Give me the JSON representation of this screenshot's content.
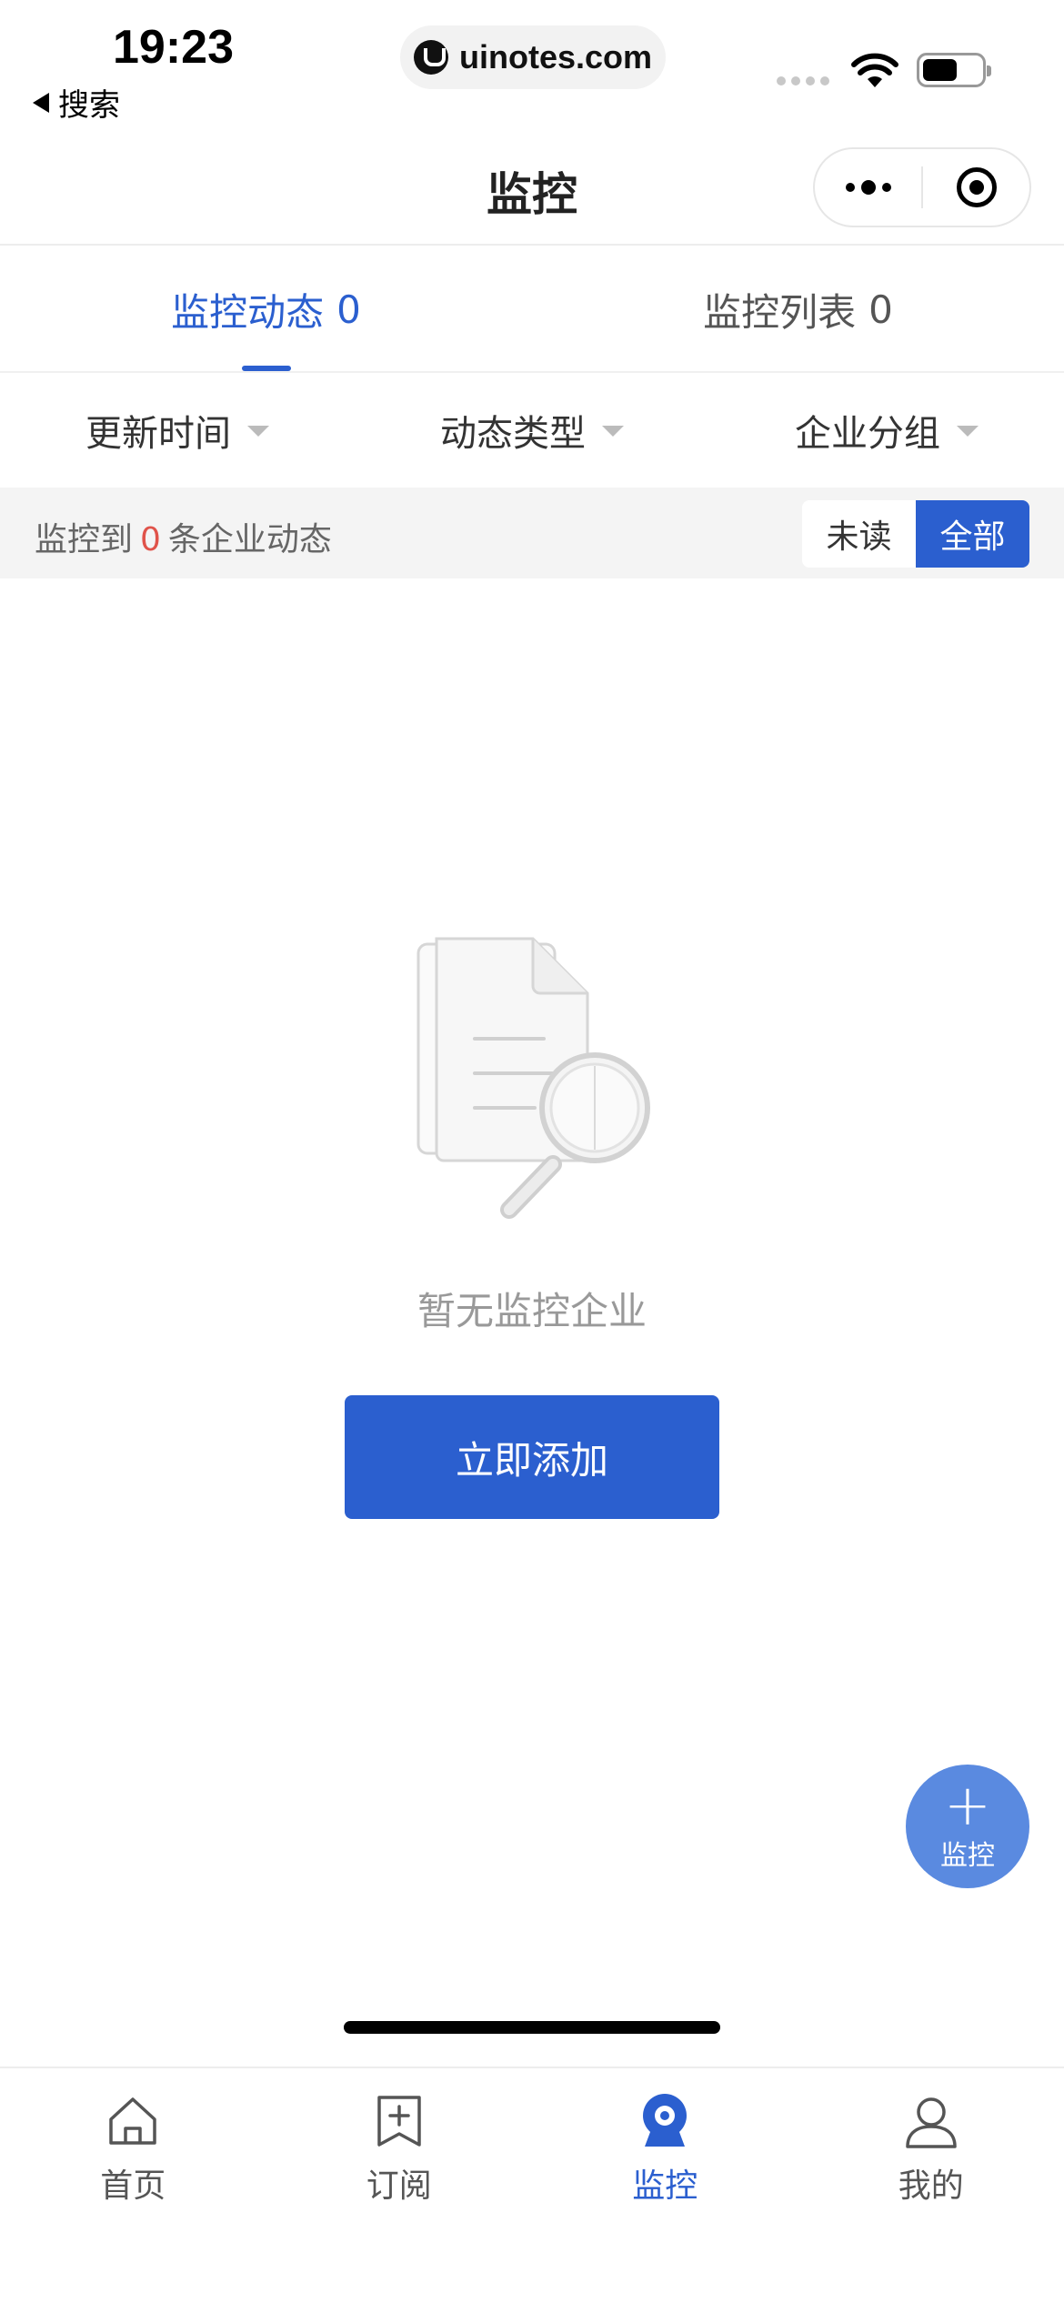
{
  "status_bar": {
    "time": "19:23",
    "back_label": "搜索",
    "url": "uinotes.com"
  },
  "nav": {
    "title": "监控"
  },
  "tabs": [
    {
      "label": "监控动态",
      "count": "0",
      "active": true
    },
    {
      "label": "监控列表",
      "count": "0",
      "active": false
    }
  ],
  "filters": [
    {
      "label": "更新时间"
    },
    {
      "label": "动态类型"
    },
    {
      "label": "企业分组"
    }
  ],
  "summary": {
    "prefix": "监控到",
    "count": "0",
    "suffix": "条企业动态",
    "toggle_unread": "未读",
    "toggle_all": "全部",
    "selected": "全部"
  },
  "empty_state": {
    "message": "暂无监控企业",
    "button_label": "立即添加"
  },
  "fab": {
    "label": "监控"
  },
  "tabbar": {
    "items": [
      {
        "label": "首页",
        "icon": "home-icon",
        "active": false
      },
      {
        "label": "订阅",
        "icon": "subscribe-icon",
        "active": false
      },
      {
        "label": "监控",
        "icon": "monitor-icon",
        "active": true
      },
      {
        "label": "我的",
        "icon": "profile-icon",
        "active": false
      }
    ]
  },
  "colors": {
    "accent": "#2b5fcf",
    "count_red": "#e0534a",
    "fab": "#5a8ae0"
  }
}
